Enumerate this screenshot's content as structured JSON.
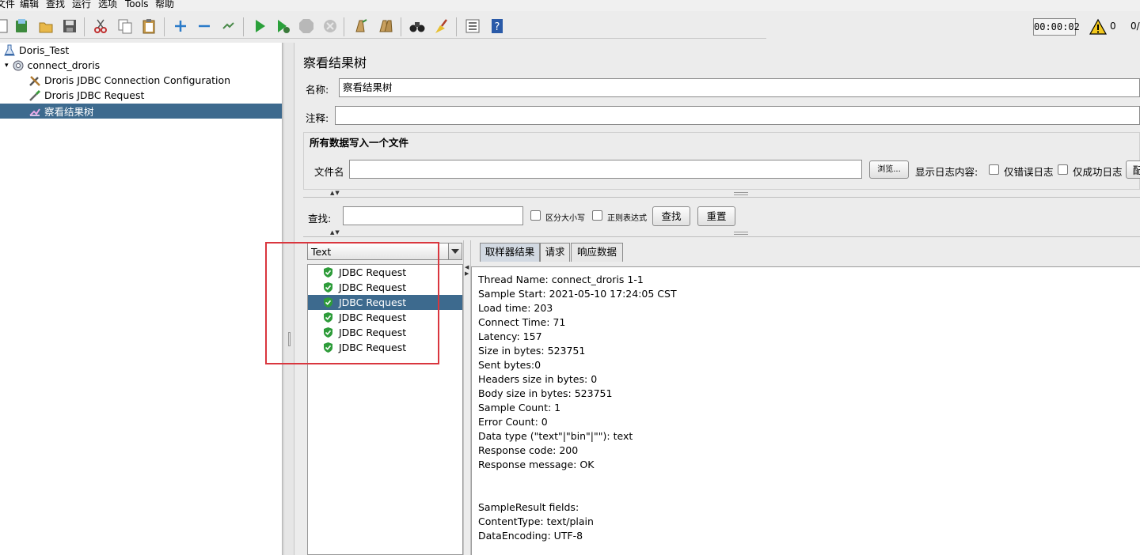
{
  "menu": [
    "文件",
    "编辑",
    "查找",
    "运行",
    "选项",
    "Tools",
    "帮助"
  ],
  "toolbar": {
    "icons": [
      "new-icon",
      "templates-icon",
      "open-icon",
      "save-icon",
      "cut-icon",
      "copy-icon",
      "paste-icon",
      "expand-icon",
      "collapse-icon",
      "toggle-icon",
      "start-icon",
      "start-no-pause-icon",
      "stop-icon",
      "shutdown-icon",
      "clear-icon",
      "clear-all-icon",
      "search-icon",
      "reset-search-icon",
      "function-helper-icon",
      "help-icon"
    ],
    "timer": "00:00:02",
    "warning_count": "0",
    "run_count": "0/"
  },
  "tree": {
    "nodes": [
      {
        "label": "Doris_Test",
        "icon": "test-plan-icon"
      },
      {
        "label": "connect_droris",
        "icon": "thread-group-icon"
      },
      {
        "label": "Droris JDBC Connection Configuration",
        "icon": "config-element-icon"
      },
      {
        "label": "Droris JDBC Request",
        "icon": "sampler-icon"
      },
      {
        "label": "察看结果树",
        "icon": "listener-icon"
      }
    ]
  },
  "panel": {
    "title": "察看结果树",
    "name_label": "名称:",
    "name_value": "察看结果树",
    "comment_label": "注释:",
    "comment_value": "",
    "file_group_title": "所有数据写入一个文件",
    "filename_label": "文件名",
    "filename_value": "",
    "browse_button": "浏览...",
    "log_content_label": "显示日志内容:",
    "errors_only_label": "仅错误日志",
    "success_only_label": "仅成功日志",
    "config_button_partial": "配"
  },
  "search": {
    "label": "查找:",
    "value": "",
    "case_sensitive_label": "区分大小写",
    "regex_label": "正则表达式",
    "search_button": "查找",
    "reset_button": "重置"
  },
  "results": {
    "renderer": "Text",
    "items": [
      "JDBC Request",
      "JDBC Request",
      "JDBC Request",
      "JDBC Request",
      "JDBC Request",
      "JDBC Request"
    ],
    "selected_index": 2
  },
  "tabs": [
    "取样器结果",
    "请求",
    "响应数据"
  ],
  "detail_lines": [
    "Thread Name: connect_droris 1-1",
    "Sample Start: 2021-05-10 17:24:05 CST",
    "Load time: 203",
    "Connect Time: 71",
    "Latency: 157",
    "Size in bytes: 523751",
    "Sent bytes:0",
    "Headers size in bytes: 0",
    "Body size in bytes: 523751",
    "Sample Count: 1",
    "Error Count: 0",
    "Data type (\"text\"|\"bin\"|\"\"): text",
    "Response code: 200",
    "Response message: OK",
    "",
    "",
    "SampleResult fields:",
    "ContentType: text/plain",
    "DataEncoding: UTF-8"
  ],
  "colors": {
    "selection": "#3d6a8e",
    "highlight_box": "#d9363e",
    "success_green": "#2e9c3a"
  }
}
